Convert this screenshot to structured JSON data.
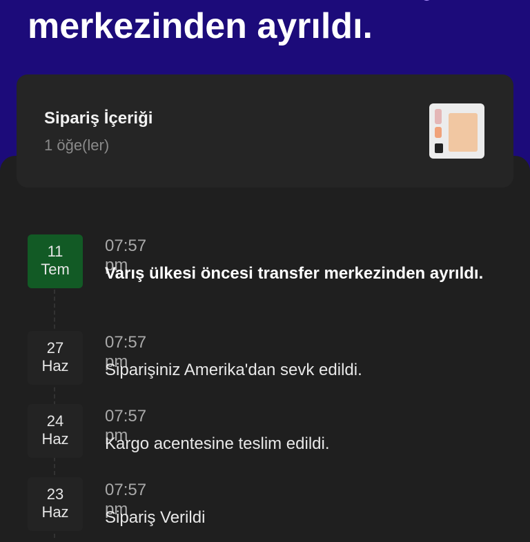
{
  "header": {
    "title": "merkezinden ayrıldı."
  },
  "order_contents": {
    "title": "Sipariş İçeriği",
    "subtitle": "1 öğe(ler)",
    "thumbnail_icon": "product-thumbnail"
  },
  "timeline": [
    {
      "day": "11",
      "month": "Tem",
      "time": "07:57 pm",
      "text": "Varış ülkesi öncesi transfer merkezinden ayrıldı.",
      "active": true
    },
    {
      "day": "27",
      "month": "Haz",
      "time": "07:57 pm",
      "text": "Siparişiniz Amerika'dan sevk edildi.",
      "active": false
    },
    {
      "day": "24",
      "month": "Haz",
      "time": "07:57 pm",
      "text": "Kargo acentesine teslim edildi.",
      "active": false
    },
    {
      "day": "23",
      "month": "Haz",
      "time": "07:57 pm",
      "text": "Sipariş Verildi",
      "active": false
    }
  ],
  "colors": {
    "header_bg": "#1c0b7a",
    "active_date_bg": "#125a25",
    "accent": "#a78bfa"
  }
}
